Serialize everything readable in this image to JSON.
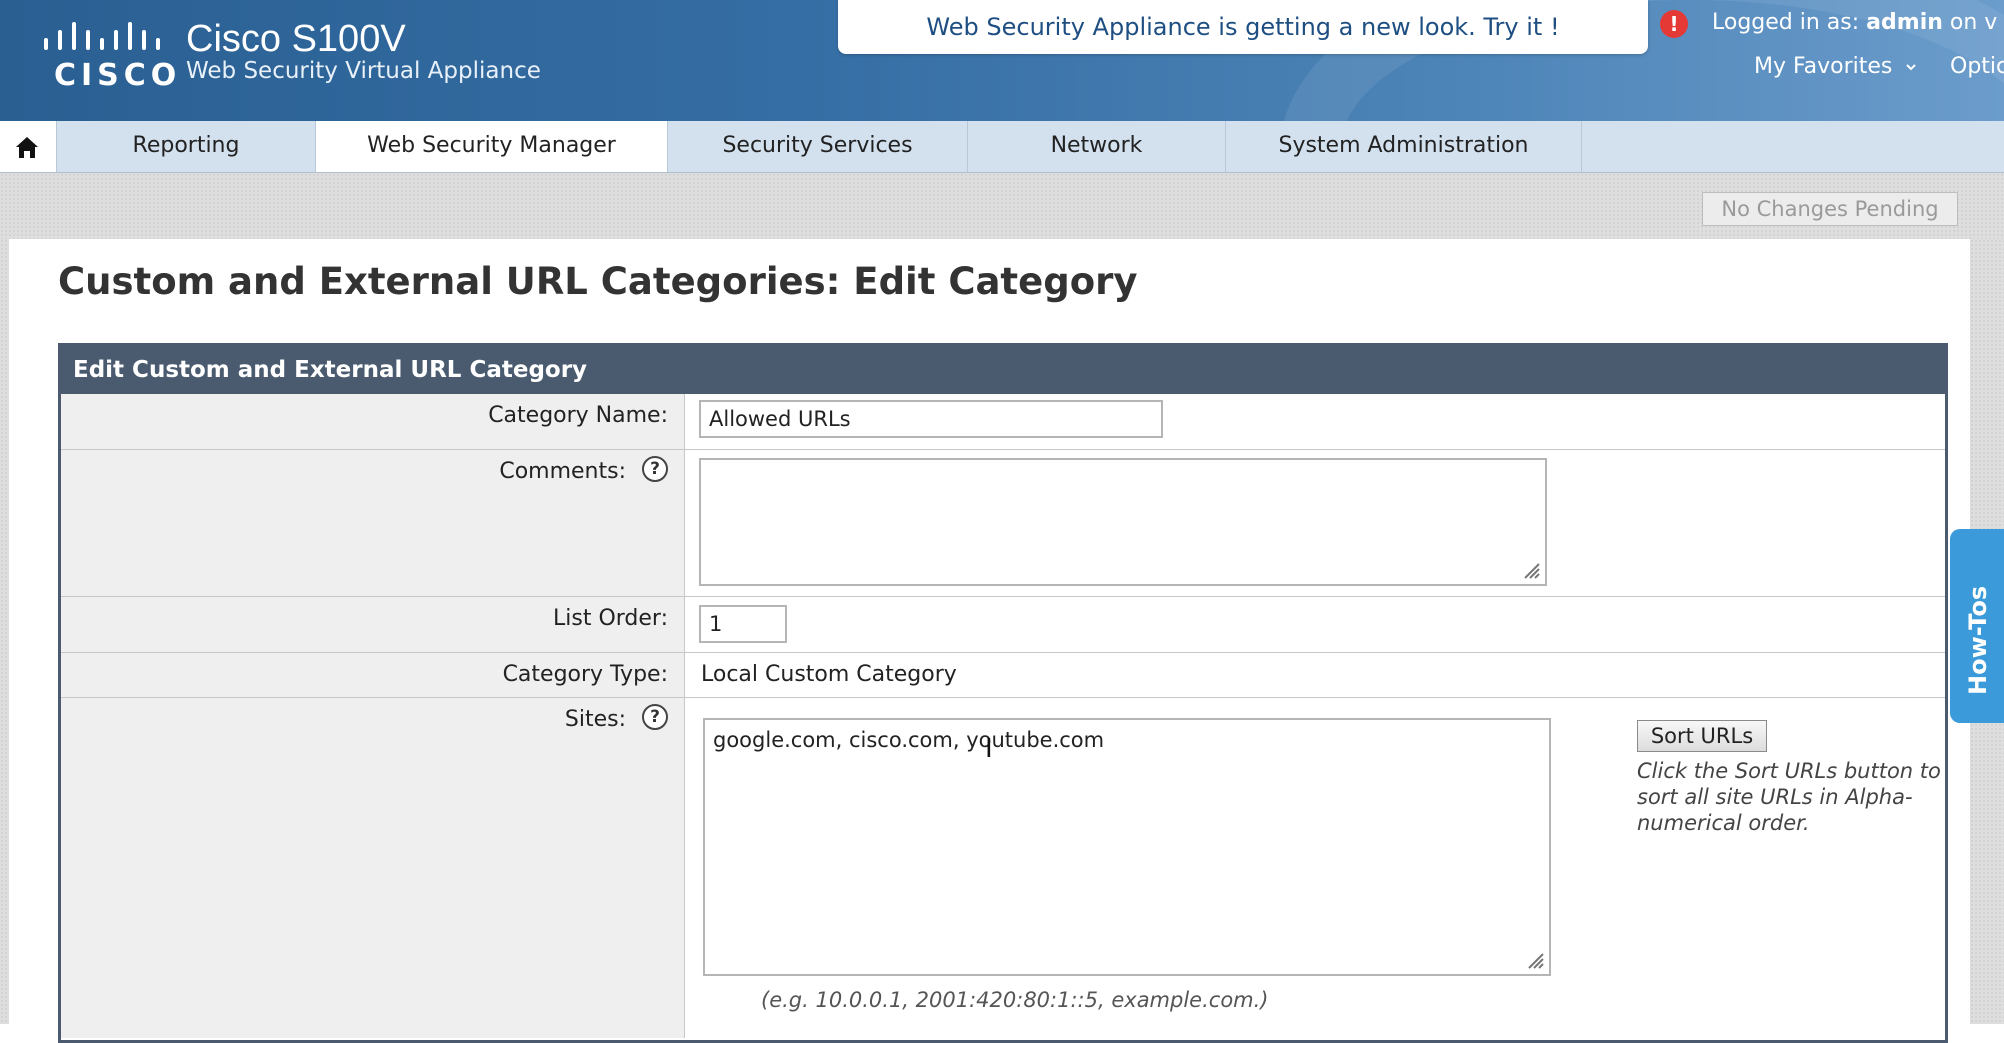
{
  "header": {
    "logo_text": "CISCO",
    "product_name": "Cisco S100V",
    "product_subtitle": "Web Security Virtual Appliance",
    "banner_text": "Web Security Appliance is getting a new look. Try it !",
    "login_prefix": "Logged in as:",
    "login_user": "admin",
    "login_suffix": "on v",
    "favorites_label": "My Favorites",
    "options_label": "Optic"
  },
  "nav": {
    "home_icon": "home-icon",
    "items": [
      {
        "label": "Reporting"
      },
      {
        "label": "Web Security Manager",
        "active": true
      },
      {
        "label": "Security Services"
      },
      {
        "label": "Network"
      },
      {
        "label": "System Administration"
      }
    ]
  },
  "pending_label": "No Changes Pending",
  "page_title": "Custom and External URL Categories: Edit Category",
  "form": {
    "panel_title": "Edit Custom and External URL Category",
    "category_name": {
      "label": "Category Name:",
      "value": "Allowed URLs"
    },
    "comments": {
      "label": "Comments:",
      "value": ""
    },
    "list_order": {
      "label": "List Order:",
      "value": "1"
    },
    "category_type": {
      "label": "Category Type:",
      "value": "Local Custom Category"
    },
    "sites": {
      "label": "Sites:",
      "value": "google.com, cisco.com, youtube.com",
      "sort_button": "Sort URLs",
      "sort_help": "Click the Sort URLs button to sort all site URLs in Alpha-numerical order.",
      "example": "(e.g. 10.0.0.1, 2001:420:80:1::5, example.com.)"
    }
  },
  "howtos_label": "How-Tos",
  "colors": {
    "header_blue": "#2a5f92",
    "nav_bg": "#d3e1ef",
    "panel_header": "#4a5b70",
    "howtos_blue": "#3b9ad9",
    "alert_red": "#e53935"
  }
}
